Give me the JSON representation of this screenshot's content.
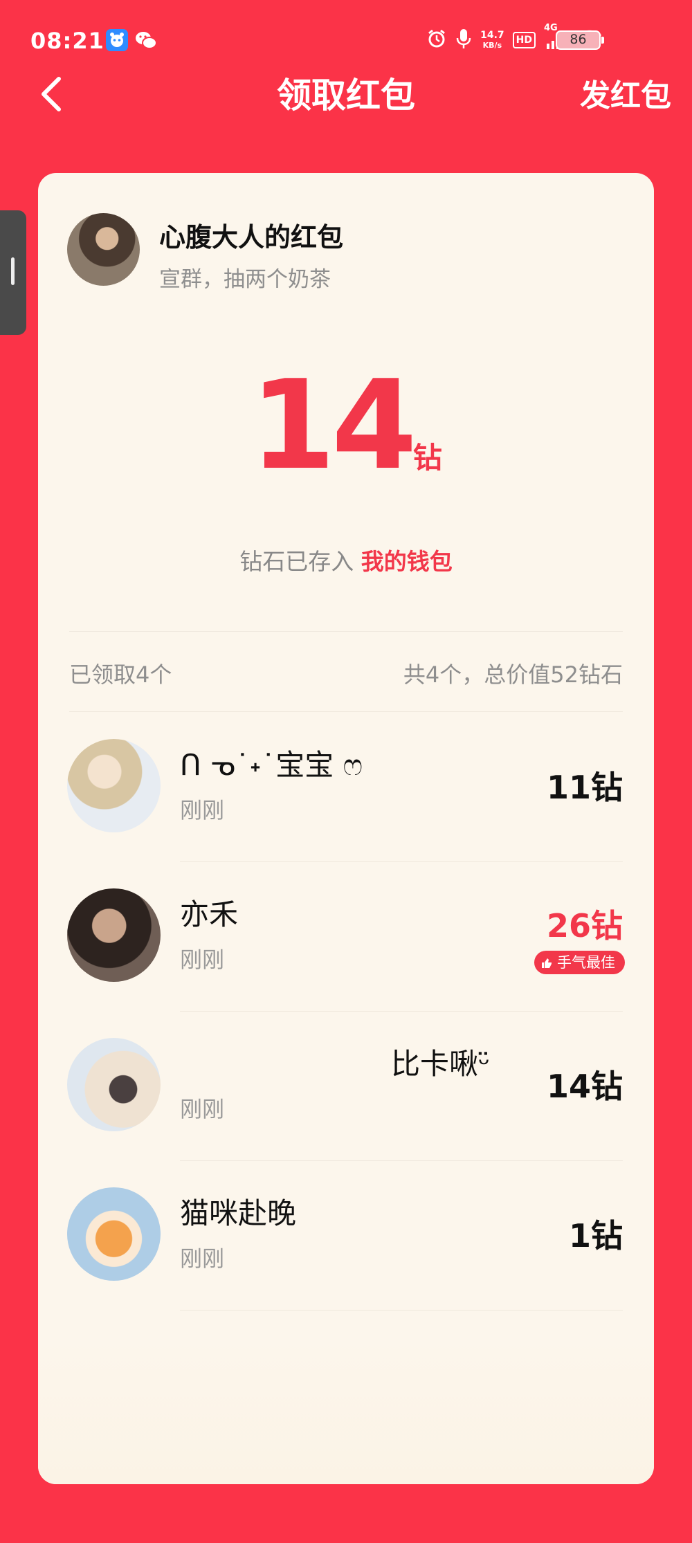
{
  "status_bar": {
    "time": "08:21",
    "net_speed_value": "14.7",
    "net_speed_unit": "KB/s",
    "hd": "HD",
    "network": "4G",
    "battery": "86"
  },
  "nav": {
    "title": "领取红包",
    "send_label": "发红包"
  },
  "sender": {
    "name": "心腹大人的红包",
    "message": "宣群，抽两个奶茶"
  },
  "received": {
    "amount": "14",
    "unit": "钻",
    "wallet_prefix": "钻石已存入",
    "wallet_link": "我的钱包"
  },
  "summary": {
    "claimed": "已领取4个",
    "total": "共4个，总价值52钻石"
  },
  "records": [
    {
      "name": "ᑎ ᓀ˙˖˙宝宝 ෆ",
      "time": "刚刚",
      "amount": "11钻",
      "best": false
    },
    {
      "name": "亦禾",
      "time": "刚刚",
      "amount": "26钻",
      "best": true,
      "badge": "手气最佳"
    },
    {
      "name": "比卡啾ᵕ̈",
      "time": "刚刚",
      "amount": "14钻",
      "best": false
    },
    {
      "name": "猫咪赴晚",
      "time": "刚刚",
      "amount": "1钻",
      "best": false
    }
  ],
  "colors": {
    "background": "#fb3348",
    "accent": "#f2374a",
    "card": "#fcf6ec"
  }
}
